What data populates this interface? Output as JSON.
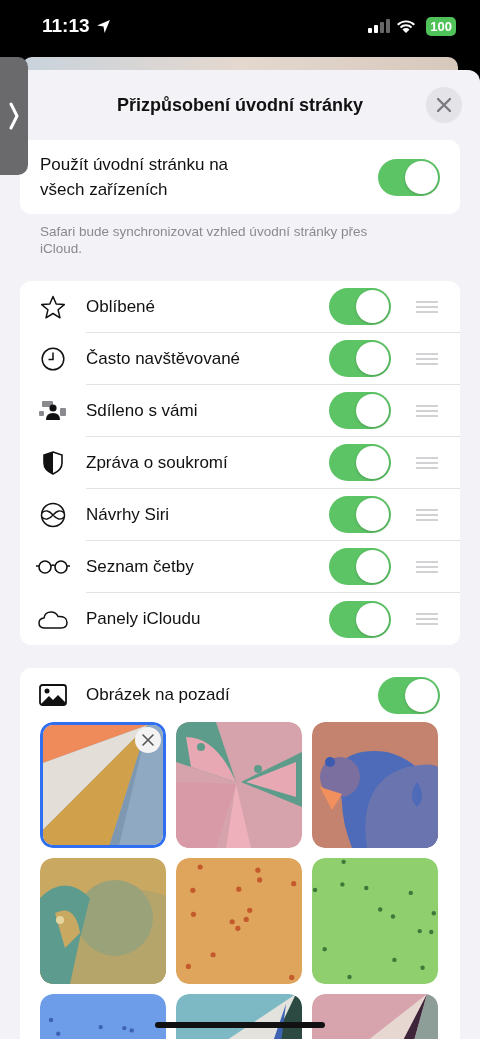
{
  "status_bar": {
    "time": "11:13",
    "battery": "100"
  },
  "sheet": {
    "title": "Přizpůsobení úvodní stránky"
  },
  "sync": {
    "label": "Použít úvodní stránku na všech zařízeních",
    "on": true,
    "footer": "Safari bude synchronizovat vzhled úvodní stránky přes iCloud."
  },
  "sections": [
    {
      "kind": "star",
      "label": "Oblíbené",
      "on": true
    },
    {
      "kind": "clock",
      "label": "Často navštěvované",
      "on": true
    },
    {
      "kind": "shared",
      "label": "Sdíleno s vámi",
      "on": true
    },
    {
      "kind": "shield",
      "label": "Zpráva o soukromí",
      "on": true
    },
    {
      "kind": "siri",
      "label": "Návrhy Siri",
      "on": true
    },
    {
      "kind": "glasses",
      "label": "Seznam četby",
      "on": true
    },
    {
      "kind": "cloud",
      "label": "Panely iCloudu",
      "on": true
    }
  ],
  "background": {
    "label": "Obrázek na pozadí",
    "on": true,
    "wallpapers": [
      {
        "selected": true
      },
      {
        "selected": false
      },
      {
        "selected": false
      },
      {
        "selected": false
      },
      {
        "selected": false
      },
      {
        "selected": false
      },
      {
        "selected": false
      },
      {
        "selected": false
      },
      {
        "selected": false
      }
    ]
  }
}
